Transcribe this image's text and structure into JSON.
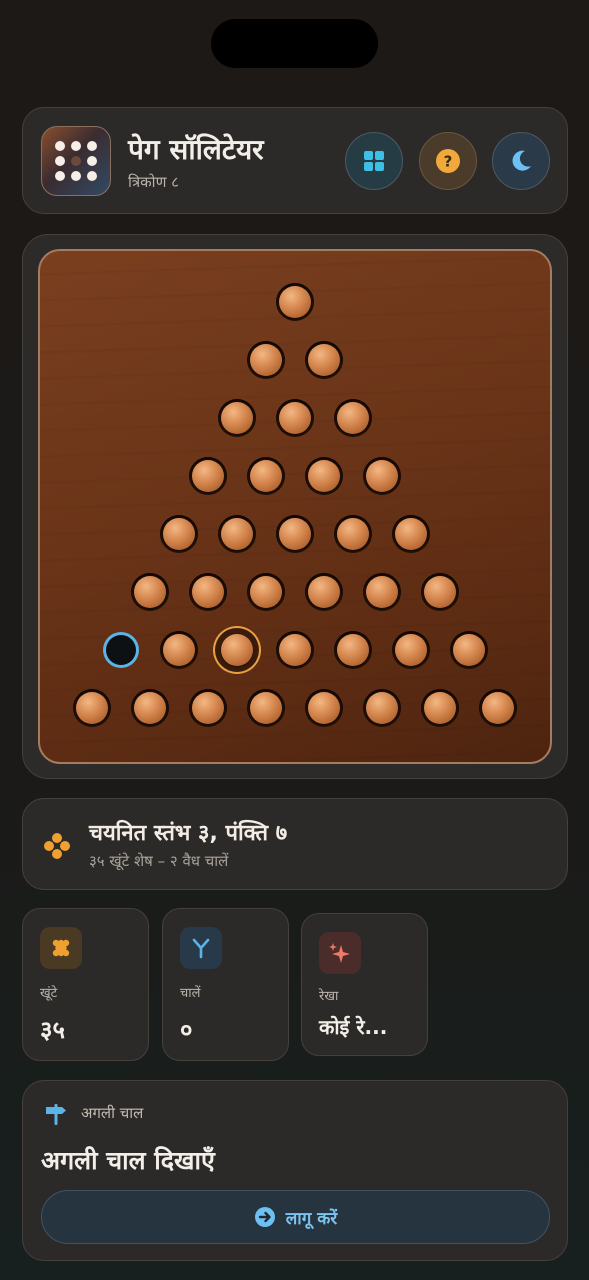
{
  "header": {
    "title": "पेग सॉलिटेयर",
    "subtitle": "त्रिकोण ८",
    "buttons": [
      {
        "name": "grid-button",
        "icon": "grid-icon"
      },
      {
        "name": "help-button",
        "icon": "question-icon"
      },
      {
        "name": "theme-button",
        "icon": "moon-icon"
      }
    ]
  },
  "board": {
    "shape": "triangle",
    "rows": [
      [
        1
      ],
      [
        1,
        1
      ],
      [
        1,
        1,
        1
      ],
      [
        1,
        1,
        1,
        1
      ],
      [
        1,
        1,
        1,
        1,
        1
      ],
      [
        1,
        1,
        1,
        1,
        1,
        1
      ],
      [
        0,
        1,
        1,
        1,
        1,
        1,
        1
      ],
      [
        1,
        1,
        1,
        1,
        1,
        1,
        1,
        1
      ]
    ],
    "selected": {
      "row": 7,
      "col": 3
    },
    "target": {
      "row": 7,
      "col": 1
    },
    "colors": {
      "peg": "#d78a52",
      "selected_ring": "#e8a040",
      "target_ring": "#5ab4e6"
    }
  },
  "status": {
    "title": "चयनित स्तंभ ३, पंक्ति ७",
    "subtitle": "३५ खूंटे शेष – २ वैध चालें",
    "icon": "pegs-icon"
  },
  "stats": [
    {
      "label": "खूंटे",
      "value": "३५",
      "icon": "pegs-icon",
      "color": "#f0a030"
    },
    {
      "label": "चालें",
      "value": "०",
      "icon": "branch-icon",
      "color": "#5ab4e6"
    },
    {
      "label": "रेखा",
      "value": "कोई रे...",
      "icon": "sparkle-icon",
      "color": "#f07a6a"
    }
  ],
  "next_move": {
    "label": "अगली चाल",
    "title": "अगली चाल दिखाएँ",
    "button_label": "लागू करें",
    "icon": "signpost-icon"
  }
}
